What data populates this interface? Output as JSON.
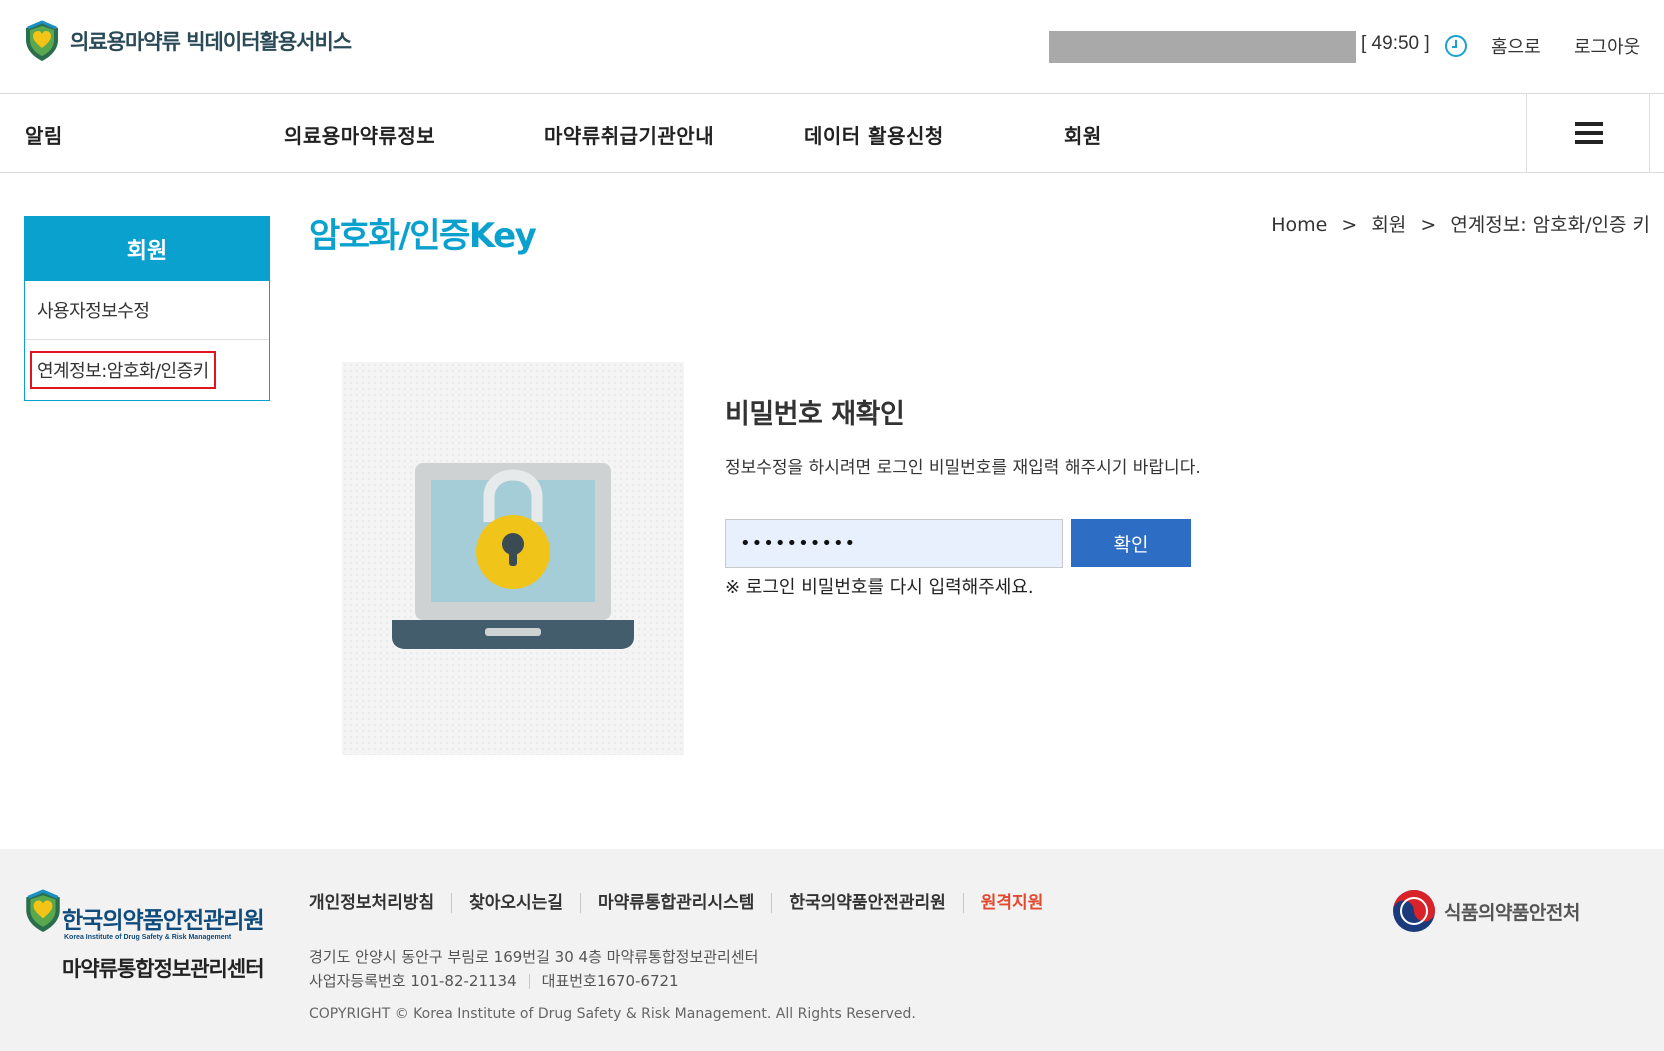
{
  "header": {
    "site_title": "의료용마약류 빅데이터활용서비스",
    "timer": "[ 49:50 ]",
    "home_link": "홈으로",
    "logout_link": "로그아웃"
  },
  "gnb": {
    "items": [
      "알림",
      "의료용마약류정보",
      "마약류취급기관안내",
      "데이터 활용신청",
      "회원"
    ]
  },
  "sidebar": {
    "title": "회원",
    "items": [
      {
        "label": "사용자정보수정"
      },
      {
        "label": "연계정보:암호화/인증키"
      }
    ]
  },
  "content": {
    "page_title": "암호화/인증Key",
    "breadcrumb": [
      "Home",
      ">",
      "회원",
      ">",
      "연계정보: 암호화/인증 키"
    ],
    "pw_title": "비밀번호 재확인",
    "pw_desc": "정보수정을 하시려면 로그인 비밀번호를 재입력 해주시기 바랍니다.",
    "password_value": "••••••••••",
    "confirm_label": "확인",
    "pw_note": "※ 로그인 비밀번호를 다시 입력해주세요."
  },
  "footer": {
    "org_name": "한국의약품안전관리원",
    "org_name_en": "Korea Institute of Drug Safety & Risk Management",
    "center_name": "마약류통합정보관리센터",
    "links": [
      "개인정보처리방침",
      "찾아오시는길",
      "마약류통합관리시스템",
      "한국의약품안전관리원",
      "원격지원"
    ],
    "address": "경기도 안양시 동안구 부림로 169번길 30 4층 마약류통합정보관리센터",
    "biz_no": "사업자등록번호 101-82-21134",
    "tel": "대표번호1670-6721",
    "copyright": "COPYRIGHT © Korea Institute of Drug Safety & Risk Management. All Rights Reserved.",
    "partner": "식품의약품안전처"
  },
  "colors": {
    "accent": "#0aa1cf",
    "button": "#2d6ec4",
    "highlight_border": "#e0141e",
    "remote_support": "#e2492f"
  }
}
